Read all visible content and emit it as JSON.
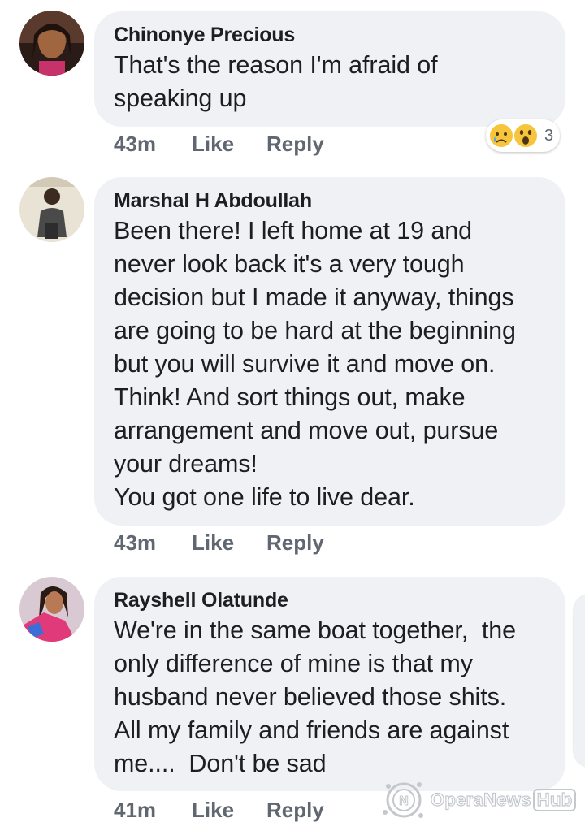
{
  "comments": [
    {
      "author": "Chinonye Precious",
      "lines": [
        "That's the reason I'm afraid of",
        "speaking up"
      ],
      "time": "43m",
      "like": "Like",
      "reply": "Reply",
      "reactions": {
        "icons": [
          "sad-face-icon",
          "wow-face-icon"
        ],
        "count": "3"
      }
    },
    {
      "author": "Marshal H Abdoullah",
      "lines": [
        "Been there! I left home at 19 and",
        "never look back it's a very tough",
        "decision but I made it anyway, things",
        "are going to be hard at the beginning",
        "but you will survive it and move on.",
        "Think! And sort things out, make",
        "arrangement and move out, pursue",
        "your dreams!",
        "You got one life to live dear."
      ],
      "time": "43m",
      "like": "Like",
      "reply": "Reply"
    },
    {
      "author": "Rayshell Olatunde",
      "lines": [
        "We're in the same boat together,  the",
        "only difference of mine is that my",
        "husband never believed those shits.",
        "All my family and friends are against",
        "me....  Don't be sad"
      ],
      "time": "41m",
      "like": "Like",
      "reply": "Reply"
    }
  ],
  "watermark": {
    "brand": "OperaNews",
    "hub": "Hub"
  },
  "colors": {
    "bubble": "#eff1f4",
    "text": "#1c1e21",
    "meta": "#606770"
  }
}
